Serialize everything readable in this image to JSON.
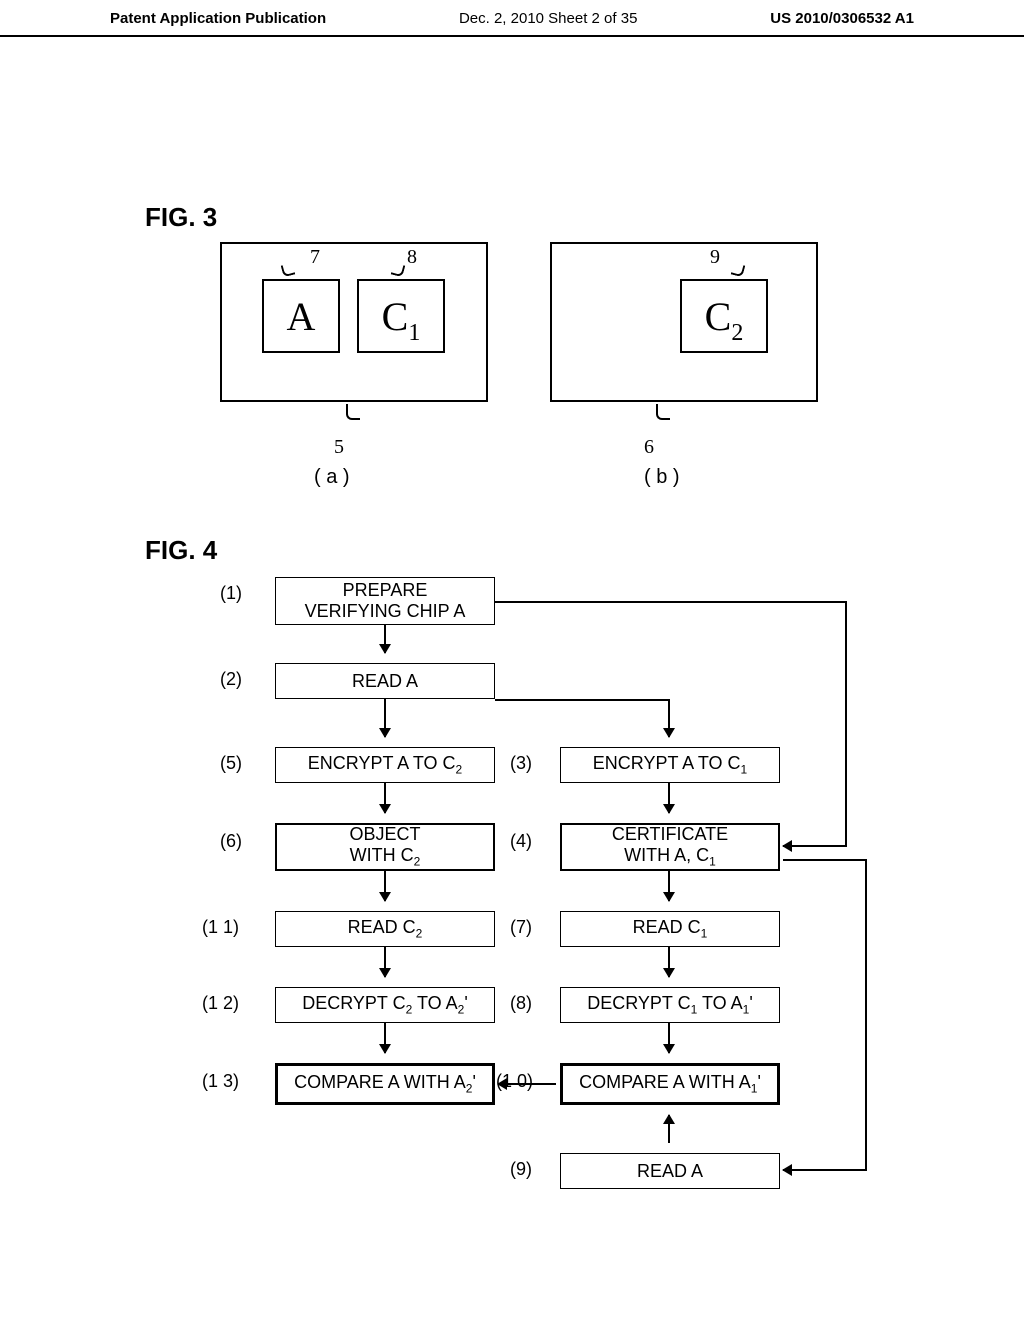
{
  "header": {
    "left": "Patent Application Publication",
    "center": "Dec. 2, 2010  Sheet 2 of 35",
    "right": "US 2010/0306532 A1"
  },
  "fig3": {
    "label": "FIG. 3",
    "boxA": "A",
    "boxC1_prefix": "C",
    "boxC1_sub": "1",
    "boxC2_prefix": "C",
    "boxC2_sub": "2",
    "n7": "7",
    "n8": "8",
    "n9": "9",
    "n5": "5",
    "n6": "6",
    "lab_a": "( a )",
    "lab_b": "( b )"
  },
  "fig4": {
    "label": "FIG. 4",
    "steps": {
      "s1": {
        "num": "(1)",
        "text": "PREPARE\nVERIFYING CHIP  A"
      },
      "s2": {
        "num": "(2)",
        "text": "READ A"
      },
      "s3": {
        "num": "(3)",
        "text_pre": "ENCRYPT A TO C",
        "sub": "1"
      },
      "s4": {
        "num": "(4)",
        "text_pre": "CERTIFICATE\nWITH A,  C",
        "sub": "1"
      },
      "s5": {
        "num": "(5)",
        "text_pre": "ENCRYPT A TO C",
        "sub": "2"
      },
      "s6": {
        "num": "(6)",
        "text_pre": "OBJECT\nWITH C",
        "sub": "2"
      },
      "s7": {
        "num": "(7)",
        "text_pre": "READ C",
        "sub": "1"
      },
      "s8": {
        "num": "(8)",
        "text_pre": "DECRYPT C",
        "sub1": "1",
        "mid": " TO A",
        "sub2": "1",
        "suf": "'"
      },
      "s9": {
        "num": "(9)",
        "text": "READ A"
      },
      "s10": {
        "num": "(1 0)",
        "text_pre": "COMPARE A WITH A",
        "sub": "1",
        "suf": "'"
      },
      "s11": {
        "num": "(1 1)",
        "text_pre": "READ C",
        "sub": "2"
      },
      "s12": {
        "num": "(1 2)",
        "text_pre": "DECRYPT C",
        "sub1": "2",
        "mid": " TO A",
        "sub2": "2",
        "suf": "'"
      },
      "s13": {
        "num": "(1 3)",
        "text_pre": "COMPARE A WITH A",
        "sub": "2",
        "suf": "'"
      }
    }
  }
}
